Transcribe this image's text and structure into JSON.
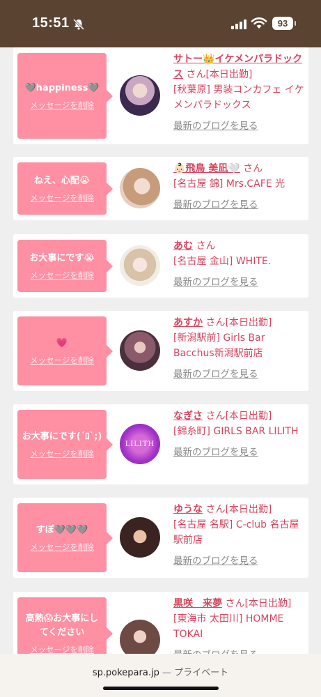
{
  "status": {
    "time": "15:51",
    "battery": "93"
  },
  "feed": {
    "items": [
      {
        "message": "🩶happiness🩶",
        "delete_label": "メッセージを削除",
        "name": "サトー👑イケメンパラドックス",
        "suffix": "さん",
        "badge": "[本日出勤]",
        "shop": "[秋葉原] 男装コンカフェ イケメンパラドックス",
        "blog": "最新のブログを見る"
      },
      {
        "message": "ねえ、心配😭",
        "delete_label": "メッセージを削除",
        "name": "👶🏻飛鳥 美凪🤍",
        "suffix": "さん",
        "badge": "",
        "shop": "[名古屋 錦] Mrs.CAFE 光",
        "blog": "最新のブログを見る"
      },
      {
        "message": "お大事にです😭",
        "delete_label": "メッセージを削除",
        "name": "あむ",
        "suffix": "さん",
        "badge": "",
        "shop": "[名古屋 金山] WHITE.",
        "blog": "最新のブログを見る"
      },
      {
        "message": "💗",
        "delete_label": "メッセージを削除",
        "name": "あすか",
        "suffix": "さん",
        "badge": "[本日出勤]",
        "shop": "[新潟駅前] Girls Bar Bacchus新潟駅前店",
        "blog": "最新のブログを見る"
      },
      {
        "message": "お大事にです(´ﾛ`;)",
        "delete_label": "メッセージを削除",
        "name": "なぎさ",
        "suffix": "さん",
        "badge": "[本日出勤]",
        "shop": "[錦糸町] GIRLS BAR LILITH",
        "blog": "最新のブログを見る",
        "logo_text": "LILITH"
      },
      {
        "message": "すぽ🩶🩶🩶",
        "delete_label": "メッセージを削除",
        "name": "ゆうな",
        "suffix": "さん",
        "badge": "[本日出勤]",
        "shop": "[名古屋 名駅] C-club 名古屋駅前店",
        "blog": "最新のブログを見る"
      },
      {
        "message": "高熱😱お大事にしてください",
        "delete_label": "メッセージを削除",
        "name": "黒咲　来夢",
        "suffix": "さん",
        "badge": "[本日出勤]",
        "shop": "[東海市 太田川] HOMME TOKAI",
        "blog": "最新のブログを見る"
      }
    ]
  },
  "browser": {
    "domain": "sp.pokepara.jp",
    "separator": "—",
    "mode": "プライベート"
  },
  "colors": {
    "accent": "#d6455f",
    "bubble": "#ff8fa3",
    "statusbar": "#5b4331"
  }
}
